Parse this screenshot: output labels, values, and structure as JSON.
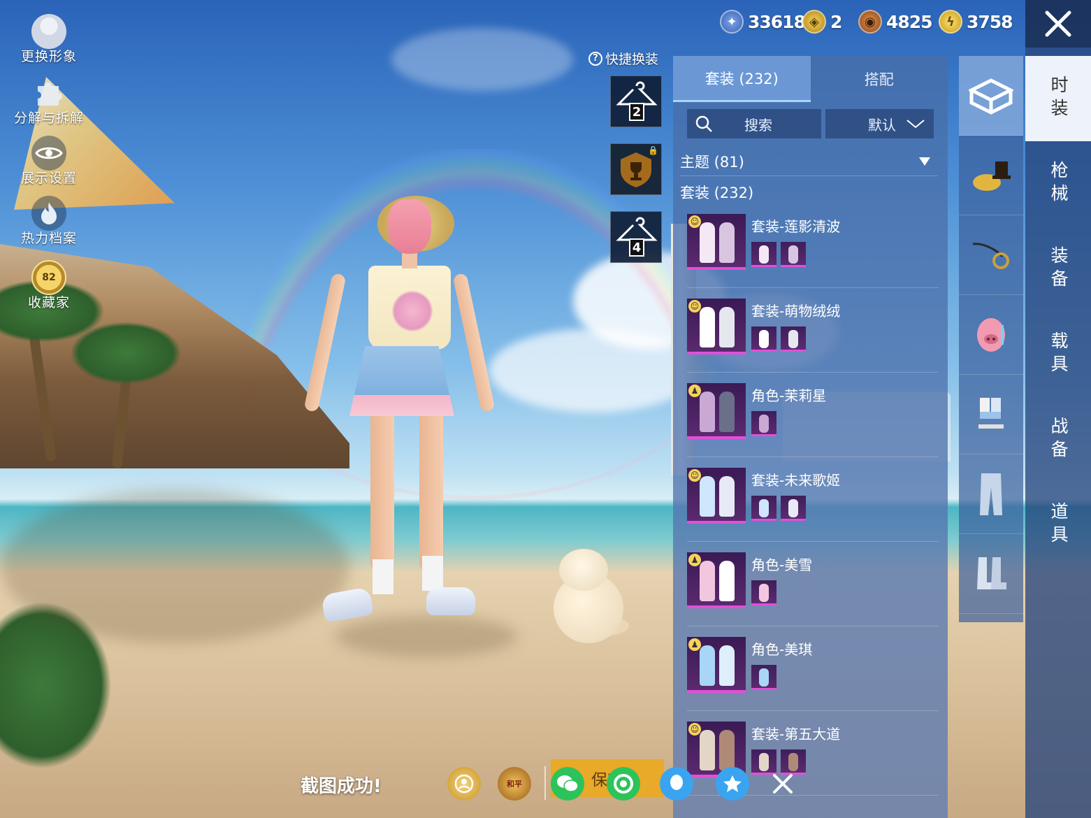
{
  "side_menu": [
    {
      "label": "更换形象",
      "icon": "avatar-icon"
    },
    {
      "label": "分解与拆解",
      "icon": "puzzle-icon"
    },
    {
      "label": "展示设置",
      "icon": "eye-icon"
    },
    {
      "label": "热力档案",
      "icon": "flame-icon"
    },
    {
      "label": "收藏家",
      "icon": "collector-badge-icon",
      "level": "82"
    }
  ],
  "currencies": [
    {
      "icon": "uc-coin-icon",
      "value": "33618",
      "color": "#3a63b5"
    },
    {
      "icon": "honor-coin-icon",
      "value": "2",
      "color": "#d6a51c"
    },
    {
      "icon": "bronze-coin-icon",
      "value": "4825",
      "color": "#b9652a"
    },
    {
      "icon": "lightning-coin-icon",
      "value": "3758",
      "color": "#e1b720"
    }
  ],
  "quick_change": {
    "title": "快捷换装",
    "help_symbol": "?",
    "slots": [
      {
        "number": "2",
        "icon": "hanger-icon"
      },
      {
        "number": "",
        "icon": "trophy-locked-icon"
      },
      {
        "number": "4",
        "icon": "hanger-icon"
      }
    ]
  },
  "panel": {
    "tabs": [
      "套装 (232)",
      "搭配"
    ],
    "search_placeholder": "搜索",
    "sort_value": "默认",
    "theme_filter": "主题 (81)",
    "section_title": "套装 (232)",
    "items": [
      {
        "name": "套装-莲影清波",
        "badge": "smile",
        "sub_count": 2,
        "colors": [
          "#f4e8f4",
          "#d8c6e0"
        ]
      },
      {
        "name": "套装-萌物绒绒",
        "badge": "smile",
        "sub_count": 2,
        "colors": [
          "#ffffff",
          "#e4e8ee"
        ]
      },
      {
        "name": "角色-茉莉星",
        "badge": "person",
        "sub_count": 1,
        "colors": [
          "#c9a9d4",
          "#6a6f8a"
        ]
      },
      {
        "name": "套装-未来歌姬",
        "badge": "smile",
        "sub_count": 2,
        "colors": [
          "#cfe6ff",
          "#e7eaf6"
        ]
      },
      {
        "name": "角色-美雪",
        "badge": "person",
        "sub_count": 1,
        "colors": [
          "#f3c6df",
          "#ffffff"
        ]
      },
      {
        "name": "角色-美琪",
        "badge": "person",
        "sub_count": 1,
        "colors": [
          "#a9d6f6",
          "#dfeefb"
        ]
      },
      {
        "name": "套装-第五大道",
        "badge": "smile",
        "sub_count": 2,
        "colors": [
          "#e3d6c6",
          "#b08a78"
        ]
      }
    ]
  },
  "categories": [
    {
      "icon": "outfit-box-icon",
      "active": true
    },
    {
      "icon": "hat-icon"
    },
    {
      "icon": "glasses-icon"
    },
    {
      "icon": "pig-mask-icon"
    },
    {
      "icon": "clothes-set-icon"
    },
    {
      "icon": "pants-icon"
    },
    {
      "icon": "boots-icon"
    }
  ],
  "right_tabs": [
    "时装",
    "枪械",
    "装备",
    "载具",
    "战备",
    "道具"
  ],
  "bottom_bar": {
    "toast": "截图成功!",
    "save_label": "保存",
    "share_icons": [
      "game-center-icon",
      "peace-elite-icon",
      "wechat-icon",
      "moments-icon",
      "qq-icon",
      "qzone-icon",
      "close-share-icon"
    ]
  }
}
